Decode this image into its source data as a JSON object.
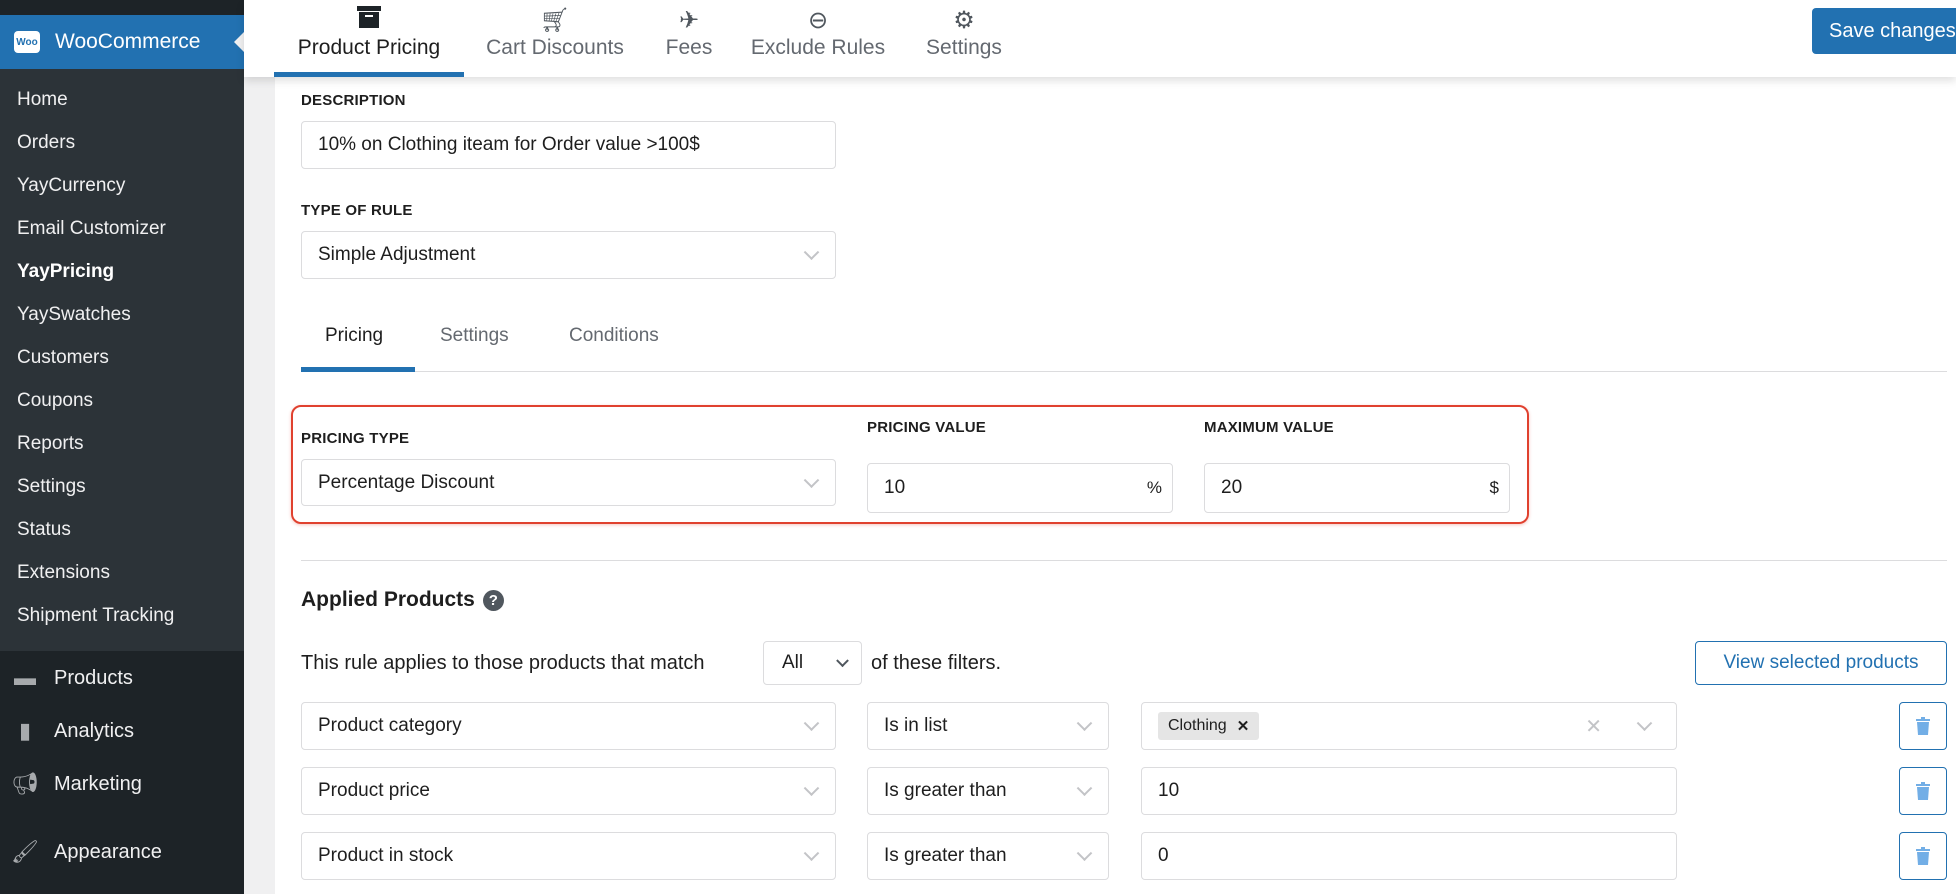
{
  "sidebar": {
    "brand": "WooCommerce",
    "brand_logo": "Woo",
    "submenu": [
      "Home",
      "Orders",
      "YayCurrency",
      "Email Customizer",
      "YayPricing",
      "YaySwatches",
      "Customers",
      "Coupons",
      "Reports",
      "Settings",
      "Status",
      "Extensions",
      "Shipment Tracking"
    ],
    "current": "YayPricing",
    "menu": [
      {
        "label": "Products",
        "icon": "archive-icon"
      },
      {
        "label": "Analytics",
        "icon": "bar-chart-icon"
      },
      {
        "label": "Marketing",
        "icon": "megaphone-icon"
      },
      {
        "label": "Appearance",
        "icon": "paintbrush-icon"
      }
    ]
  },
  "header": {
    "tabs": [
      {
        "label": "Product Pricing",
        "icon": "archive-icon"
      },
      {
        "label": "Cart Discounts",
        "icon": "cart-icon"
      },
      {
        "label": "Fees",
        "icon": "plane-icon"
      },
      {
        "label": "Exclude Rules",
        "icon": "minus-circle-icon"
      },
      {
        "label": "Settings",
        "icon": "gear-icon"
      }
    ],
    "active_tab": "Product Pricing",
    "save_label": "Save changes"
  },
  "form": {
    "description_label": "DESCRIPTION",
    "description_value": "10% on Clothing iteam for Order value >100$",
    "type_label": "TYPE OF RULE",
    "type_value": "Simple Adjustment",
    "rule_tabs": [
      "Pricing",
      "Settings",
      "Conditions"
    ],
    "active_rule_tab": "Pricing",
    "pricing_type_label": "PRICING TYPE",
    "pricing_type_value": "Percentage Discount",
    "pricing_value_label": "PRICING VALUE",
    "pricing_value": "10",
    "pricing_value_unit": "%",
    "max_value_label": "MAXIMUM VALUE",
    "max_value": "20",
    "max_value_unit": "$"
  },
  "applied": {
    "title": "Applied Products",
    "help_icon": "?",
    "sentence_before": "This rule applies to those products that match",
    "match_value": "All",
    "sentence_after": "of these filters.",
    "view_button": "View selected products",
    "filters": [
      {
        "field": "Product category",
        "operator": "Is in list",
        "tag": "Clothing",
        "tag_remove": "✕",
        "value": ""
      },
      {
        "field": "Product price",
        "operator": "Is greater than",
        "value": "10"
      },
      {
        "field": "Product in stock",
        "operator": "Is greater than",
        "value": "0"
      }
    ]
  },
  "colors": {
    "accent": "#2271b1",
    "highlight_box": "#e0412f",
    "sidebar": "#1d2327",
    "submenu": "#2c3338"
  }
}
